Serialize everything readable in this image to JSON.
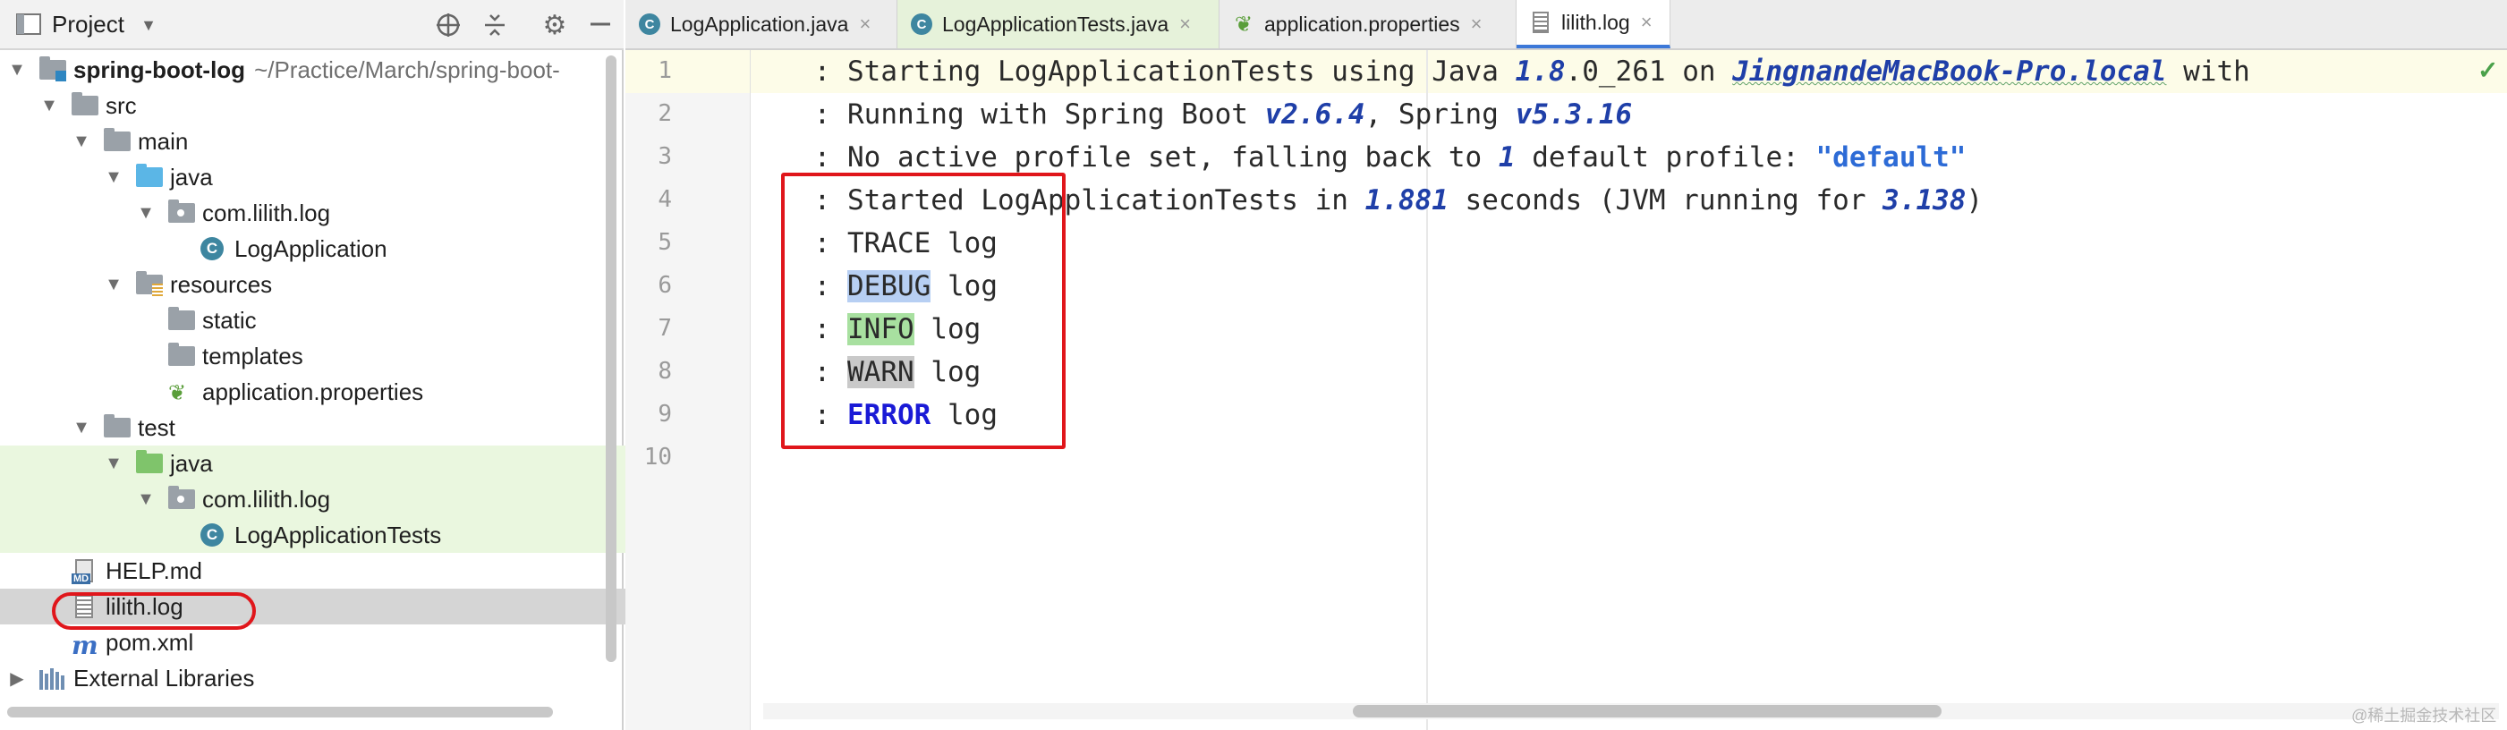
{
  "project_panel": {
    "title": "Project",
    "icons": [
      "project-view-icon",
      "dropdown-chevron-icon",
      "locate-icon",
      "collapse-all-icon",
      "settings-gear-icon",
      "minimize-icon"
    ],
    "tree": [
      {
        "label": "spring-boot-log",
        "path": "~/Practice/March/spring-boot-",
        "icon": "module-folder-icon",
        "expanded": true
      },
      {
        "label": "src",
        "icon": "folder-icon",
        "expanded": true
      },
      {
        "label": "main",
        "icon": "folder-icon",
        "expanded": true
      },
      {
        "label": "java",
        "icon": "source-folder-icon",
        "expanded": true
      },
      {
        "label": "com.lilith.log",
        "icon": "package-icon",
        "expanded": true
      },
      {
        "label": "LogApplication",
        "icon": "spring-boot-class-icon"
      },
      {
        "label": "resources",
        "icon": "resources-folder-icon",
        "expanded": true
      },
      {
        "label": "static",
        "icon": "folder-icon"
      },
      {
        "label": "templates",
        "icon": "folder-icon"
      },
      {
        "label": "application.properties",
        "icon": "spring-properties-icon"
      },
      {
        "label": "test",
        "icon": "folder-icon",
        "expanded": true
      },
      {
        "label": "java",
        "icon": "test-source-folder-icon",
        "expanded": true
      },
      {
        "label": "com.lilith.log",
        "icon": "package-icon",
        "expanded": true
      },
      {
        "label": "LogApplicationTests",
        "icon": "spring-boot-class-icon"
      },
      {
        "label": "HELP.md",
        "icon": "markdown-file-icon"
      },
      {
        "label": "lilith.log",
        "icon": "log-file-icon",
        "selected": true
      },
      {
        "label": "pom.xml",
        "icon": "maven-icon"
      },
      {
        "label": "External Libraries",
        "icon": "libraries-icon",
        "expanded": false
      }
    ]
  },
  "editor": {
    "tabs": [
      {
        "label": "LogApplication.java",
        "icon": "spring-boot-class-icon"
      },
      {
        "label": "LogApplicationTests.java",
        "icon": "spring-boot-class-icon"
      },
      {
        "label": "application.properties",
        "icon": "spring-properties-icon"
      },
      {
        "label": "lilith.log",
        "icon": "log-file-icon",
        "active": true
      }
    ],
    "close_glyph": "×",
    "line_numbers": [
      "1",
      "2",
      "3",
      "4",
      "5",
      "6",
      "7",
      "8",
      "9",
      "10"
    ],
    "lines": {
      "l1": {
        "a": " : Starting LogApplicationTests using Java ",
        "b": "1.8",
        "c": ".0_261 on ",
        "d": "JingnandeMacBook-Pro.local",
        "e": " with"
      },
      "l2": {
        "a": " : Running with Spring Boot ",
        "b": "v2.6.4",
        "c": ", Spring ",
        "d": "v5.3.16"
      },
      "l3": {
        "a": " : No active profile set, falling back to ",
        "b": "1",
        "c": " default profile: ",
        "d": "\"default\""
      },
      "l4": {
        "a": " : Started LogApplicationTests in ",
        "b": "1.881",
        "c": " seconds (JVM running for ",
        "d": "3.138",
        "e": ")"
      },
      "l5": {
        "a": " : TRACE log"
      },
      "l6": {
        "a": " : ",
        "b": "DEBUG",
        "c": " log"
      },
      "l7": {
        "a": " : ",
        "b": "INFO",
        "c": " log"
      },
      "l8": {
        "a": " : ",
        "b": "WARN",
        "c": " log"
      },
      "l9": {
        "a": " : ",
        "b": "ERROR",
        "c": " log"
      }
    }
  },
  "watermark": "@稀土掘金技术社区"
}
